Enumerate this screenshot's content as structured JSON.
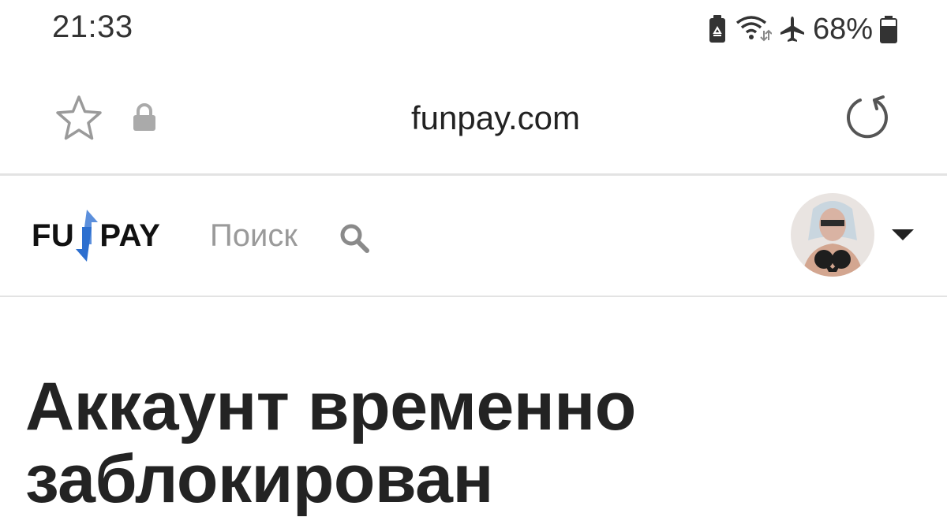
{
  "status_bar": {
    "time": "21:33",
    "battery_percent": "68%",
    "icons": [
      "battery-saver-icon",
      "wifi-icon",
      "airplane-icon",
      "battery-icon"
    ]
  },
  "browser": {
    "url": "funpay.com",
    "icons": [
      "star-icon",
      "lock-icon",
      "reload-icon"
    ]
  },
  "site": {
    "logo": {
      "left": "FU",
      "right": "PAY",
      "icon": "funpay-arrows-icon"
    },
    "search_label": "Поиск",
    "search_icon": "search-icon",
    "dropdown_icon": "caret-down-icon"
  },
  "main": {
    "title": "Аккаунт временно заблокирован"
  },
  "colors": {
    "accent_blue": "#4a8fdc",
    "text_dark": "#222222",
    "muted_gray": "#9a9a9a",
    "divider": "#e3e3e3"
  }
}
